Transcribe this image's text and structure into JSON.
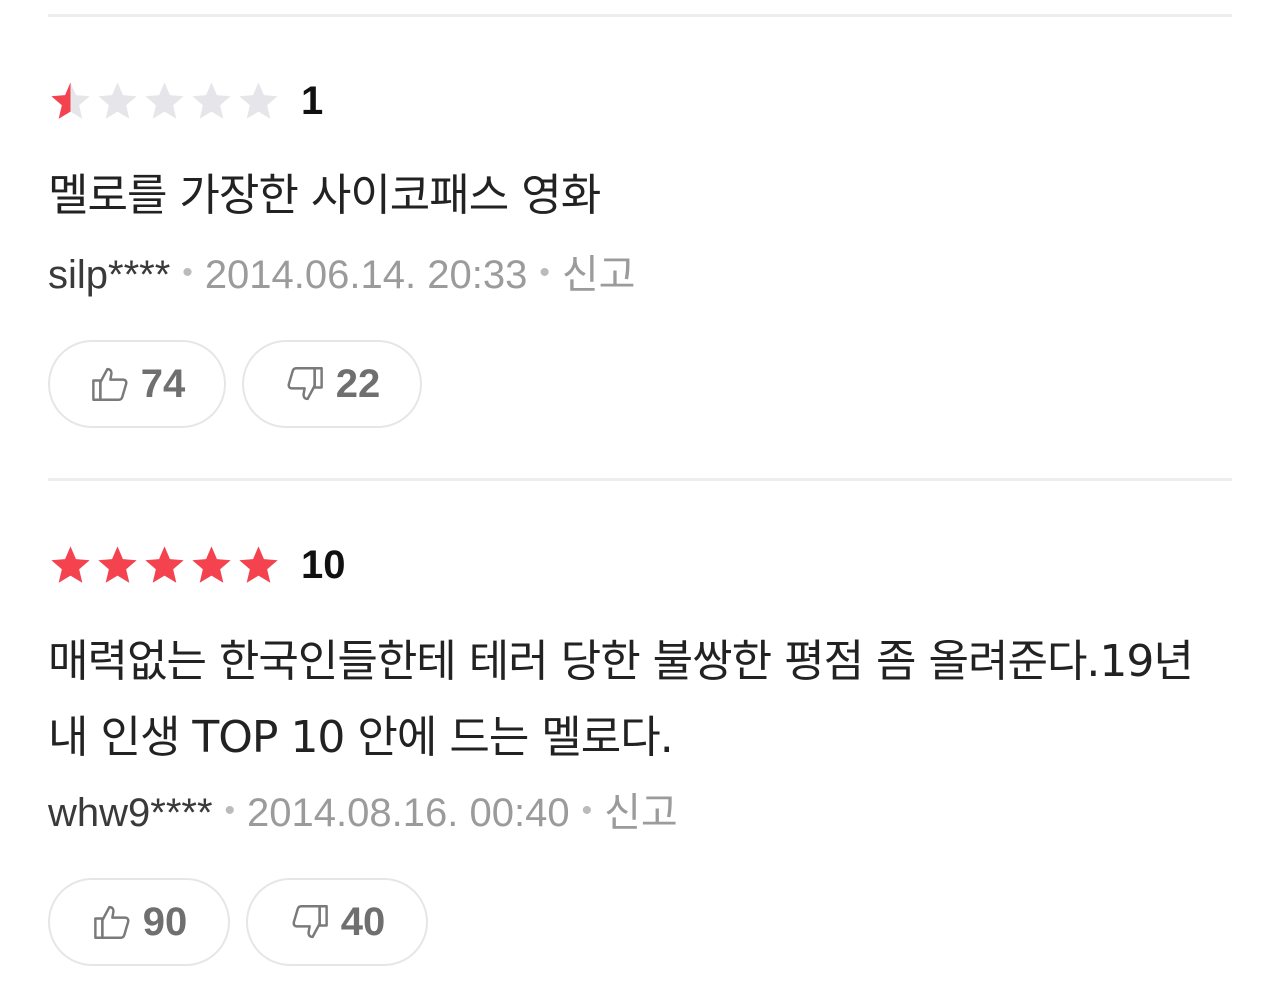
{
  "colors": {
    "star_filled": "#f5424f",
    "star_empty": "#e6e6ea",
    "divider": "#eeeeee",
    "meta_gray": "#9b9b9b"
  },
  "reviews": [
    {
      "rating_stars": 0.5,
      "score": "1",
      "comment": "멜로를 가장한 사이코패스 영화",
      "author": "silp****",
      "separator": "•",
      "date": "2014.06.14. 20:33",
      "report_label": "신고",
      "like_icon": "thumbs-up-icon",
      "likes": "74",
      "dislike_icon": "thumbs-down-icon",
      "dislikes": "22"
    },
    {
      "rating_stars": 5,
      "score": "10",
      "comment": "매력없는 한국인들한테 테러 당한 불쌍한 평점 좀 올려준다.19년 내 인생 TOP 10 안에 드는 멜로다.",
      "author": "whw9****",
      "separator": "•",
      "date": "2014.08.16. 00:40",
      "report_label": "신고",
      "like_icon": "thumbs-up-icon",
      "likes": "90",
      "dislike_icon": "thumbs-down-icon",
      "dislikes": "40"
    }
  ]
}
